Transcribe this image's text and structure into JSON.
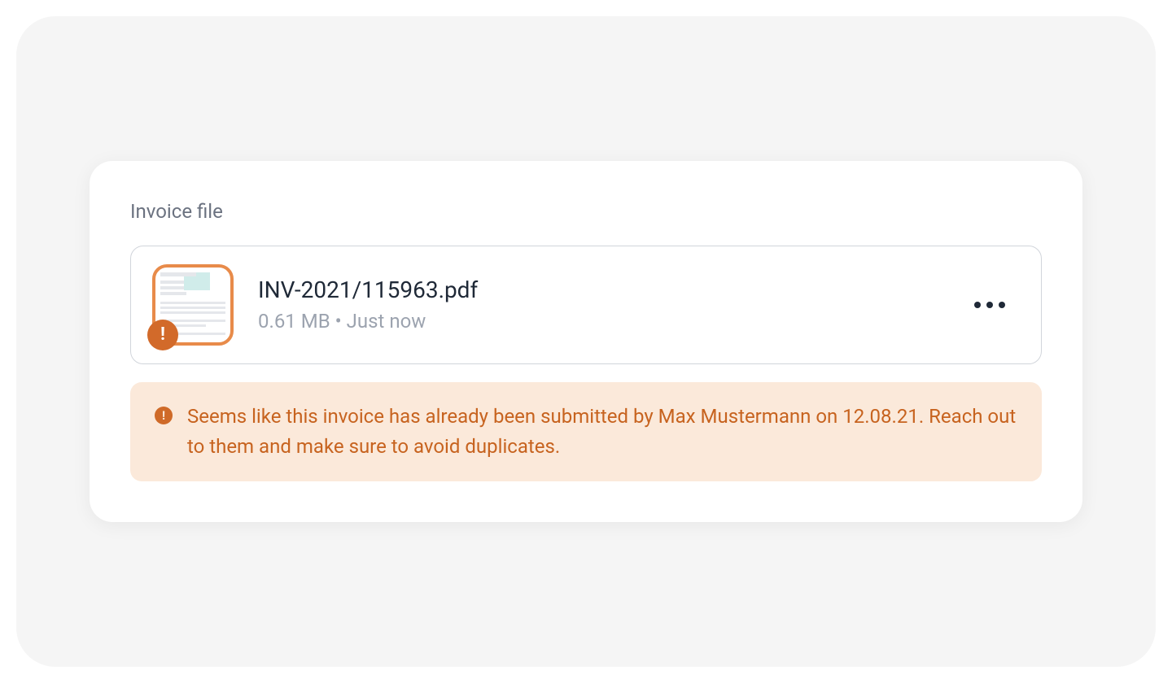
{
  "section": {
    "label": "Invoice file"
  },
  "file": {
    "name": "INV-2021/115963.pdf",
    "meta": "0.61 MB • Just now"
  },
  "alert": {
    "message": "Seems like this invoice has already been submitted by Max Mustermann on 12.08.21. Reach out to them and make sure to avoid duplicates."
  }
}
